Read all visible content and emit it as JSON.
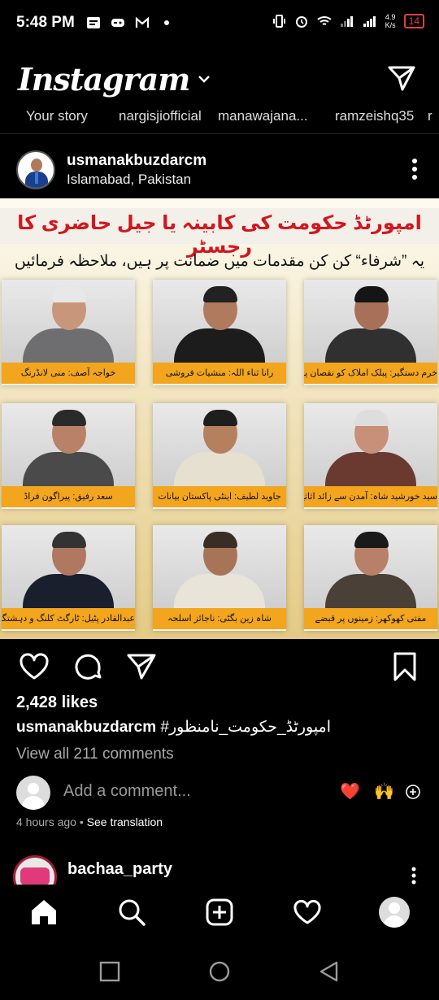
{
  "status_bar": {
    "time": "5:48 PM",
    "net_speed_top": "4.9",
    "net_speed_bottom": "K/s",
    "battery": "14"
  },
  "header": {
    "logo": "Instagram"
  },
  "stories": [
    "Your story",
    "nargisjiofficial",
    "manawajana...",
    "ramzeishq35",
    "r"
  ],
  "post": {
    "username": "usmanakbuzdarcm",
    "location": "Islamabad, Pakistan",
    "image": {
      "title": "امپورٹڈ حکومت کی کابینہ یا جیل حاضری کا رجسٹر",
      "subtitle": "یہ ”شرفاء“ کن کن مقدمات میں ضمانت پر ہیں، ملاحظہ فرمائیں",
      "cards": [
        {
          "caption": "خواجہ آصف: منی لانڈرنگ"
        },
        {
          "caption": "رانا ثناء اللہ: منشیات فروشی"
        },
        {
          "caption": "خرم دستگیر: پبلک املاک کو نقصان پہنچانا"
        },
        {
          "caption": "سعد رفیق: پیراگون فراڈ"
        },
        {
          "caption": "جاوید لطیف: اینٹی پاکستان بیانات"
        },
        {
          "caption": "سید خورشید شاہ: آمدن سے زائد اثاثے"
        },
        {
          "caption": "عبدالقادر پٹیل: ٹارگٹ کلنگ و دہشتگردوں کی معاونت"
        },
        {
          "caption": "شاہ زین بگٹی: ناجائز اسلحہ"
        },
        {
          "caption": "مفتی کھوکھر: زمینوں پر قبضے"
        }
      ]
    },
    "likes": "2,428 likes",
    "caption_user": "usmanakbuzdarcm",
    "caption_text": " #امپورٹڈ_حکومت_نامنظور",
    "view_comments": "View all 211 comments",
    "comment_placeholder": "Add a comment...",
    "time": "4 hours ago",
    "see_translation": "See translation"
  },
  "next_post": {
    "username": "bachaa_party"
  },
  "icons": {
    "heart_reaction": "❤️",
    "hands_reaction": "🙌"
  },
  "colors": {
    "accent_red": "#d3161e",
    "caption_orange": "#f2a51d"
  }
}
